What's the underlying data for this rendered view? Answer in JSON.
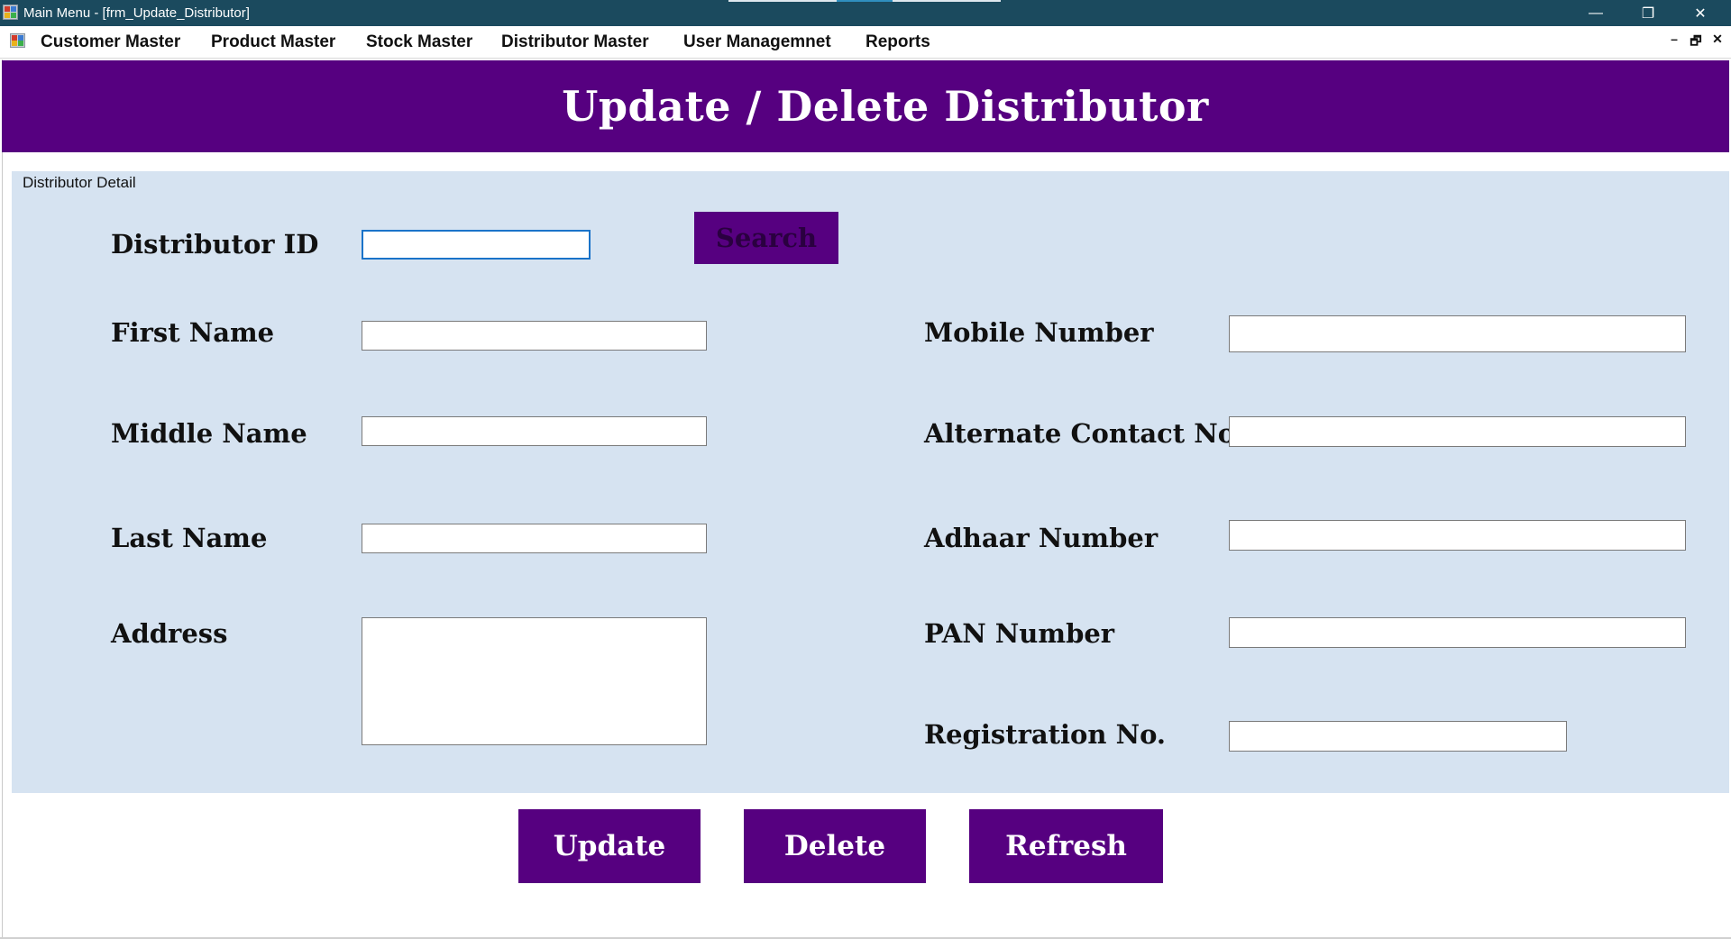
{
  "window": {
    "title": "Main Menu - [frm_Update_Distributor]",
    "controls": {
      "minimize": "—",
      "restore": "❐",
      "close": "✕"
    }
  },
  "menu": {
    "items": [
      "Customer Master",
      "Product Master",
      "Stock Master",
      "Distributor Master",
      "User Managemnet",
      "Reports"
    ],
    "mdi_controls": {
      "minimize": "–",
      "restore": "🗗",
      "close": "✕"
    }
  },
  "form": {
    "title": "Update / Delete Distributor",
    "group_caption": "Distributor Detail",
    "labels": {
      "distributor_id": "Distributor ID",
      "first_name": "First Name",
      "middle_name": "Middle Name",
      "last_name": "Last Name",
      "address": "Address",
      "mobile_number": "Mobile Number",
      "alternate_contact": "Alternate Contact No.",
      "adhaar_number": "Adhaar Number",
      "pan_number": "PAN Number",
      "registration_no": "Registration No."
    },
    "values": {
      "distributor_id": "",
      "first_name": "",
      "middle_name": "",
      "last_name": "",
      "address": "",
      "mobile_number": "",
      "alternate_contact": "",
      "adhaar_number": "",
      "pan_number": "",
      "registration_no": ""
    },
    "buttons": {
      "search": "Search",
      "update": "Update",
      "delete": "Delete",
      "refresh": "Refresh"
    }
  },
  "colors": {
    "title_bar": "#1b4a5e",
    "accent_purple": "#560080",
    "group_background": "#d6e3f1",
    "focus_border": "#1a73c9"
  }
}
